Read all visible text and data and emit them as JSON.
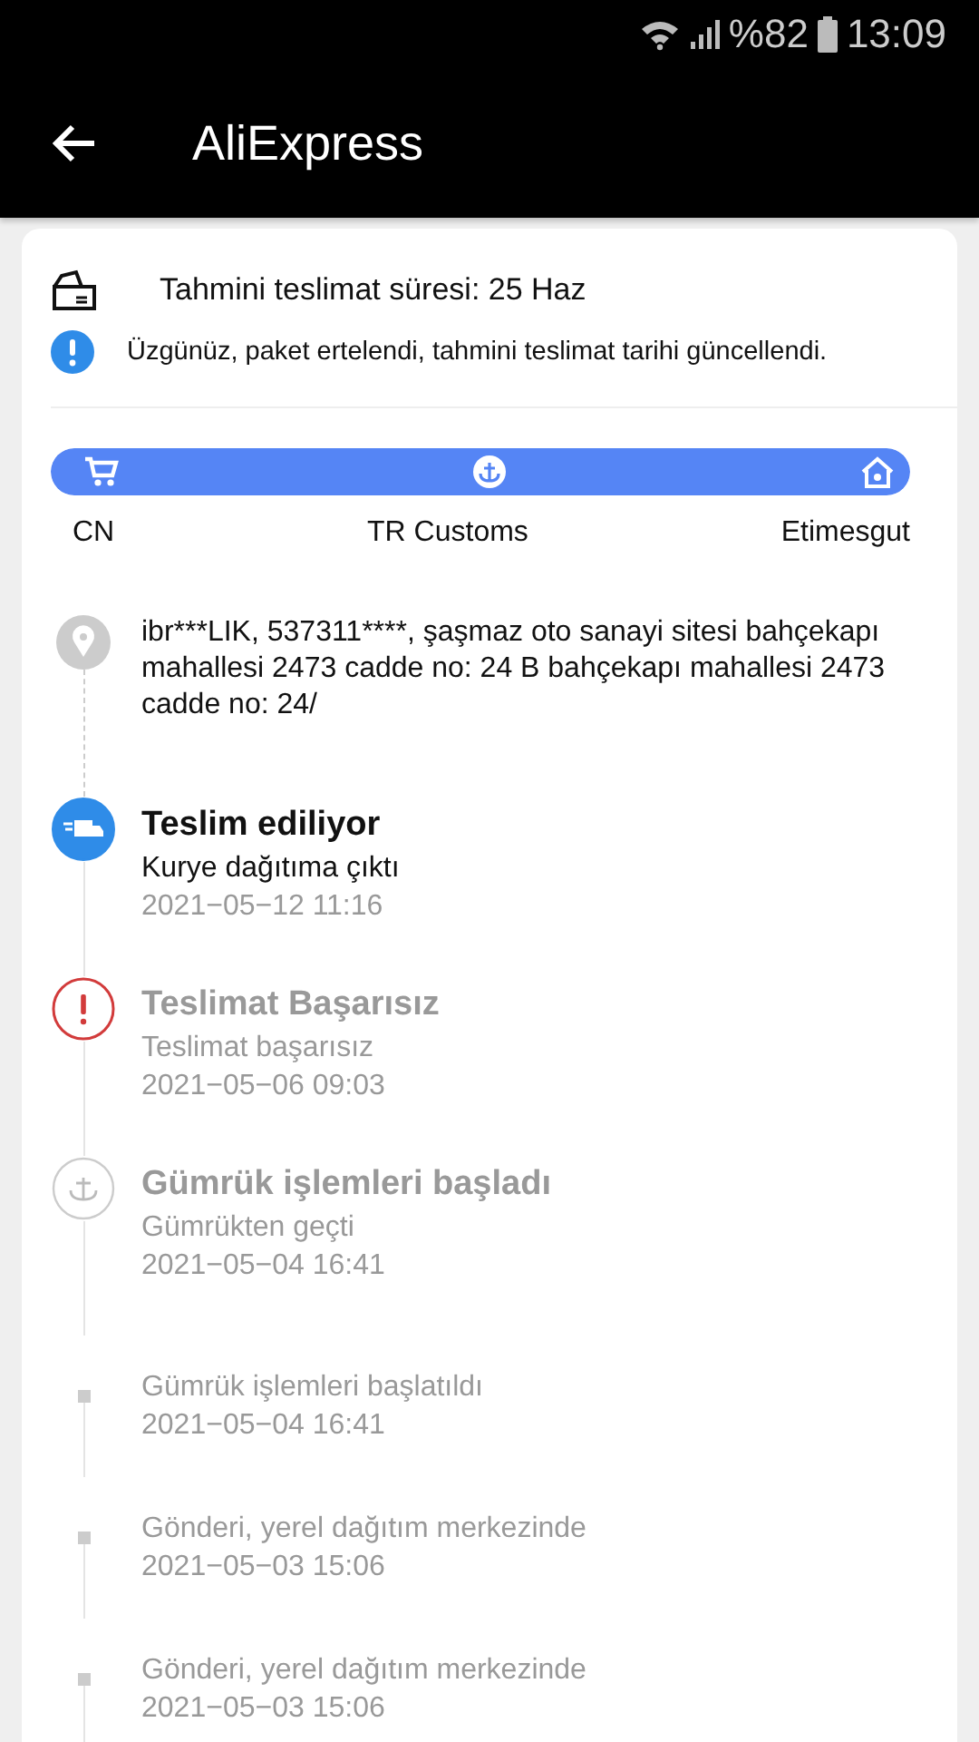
{
  "status_bar": {
    "battery": "%82",
    "time": "13:09"
  },
  "app_bar": {
    "title": "AliExpress"
  },
  "delivery": {
    "estimate": "Tahmini teslimat süresi: 25 Haz",
    "notice": "Üzgünüz, paket ertelendi, tahmini teslimat tarihi güncellendi."
  },
  "route": {
    "level": 1,
    "stops": [
      {
        "label": "CN",
        "kind": "cart"
      },
      {
        "label": "TR Customs",
        "kind": "anchor"
      },
      {
        "label": "Etimesgut",
        "kind": "home"
      }
    ]
  },
  "address": {
    "lines": [
      "ibr***LIK,  537311****,  şaşmaz oto sanayi sitesi bahçekapı mahallesi 2473 cadde no: 24 B bahçekapı mahallesi 2473 cadde no: 24/"
    ]
  },
  "events": [
    {
      "kind": "truck",
      "active": true,
      "title": "Teslim ediliyor",
      "detail": "Kurye dağıtıma çıktı",
      "time": "2021−05−12 11:16"
    },
    {
      "kind": "alert",
      "active": false,
      "title": "Teslimat Başarısız",
      "detail": "Teslimat başarısız",
      "time": "2021−05−06 09:03"
    },
    {
      "kind": "anchor",
      "active": false,
      "title": "Gümrük işlemleri başladı",
      "detail": "Gümrükten geçti",
      "time": "2021−05−04 16:41"
    },
    {
      "kind": "minor",
      "active": false,
      "detail": "Gümrük işlemleri başlatıldı",
      "time": "2021−05−04 16:41"
    },
    {
      "kind": "minor",
      "active": false,
      "detail": "Gönderi, yerel dağıtım merkezinde",
      "time": "2021−05−03 15:06"
    },
    {
      "kind": "minor",
      "active": false,
      "detail": "Gönderi, yerel dağıtım merkezinde",
      "time": "2021−05−03 15:06"
    }
  ]
}
